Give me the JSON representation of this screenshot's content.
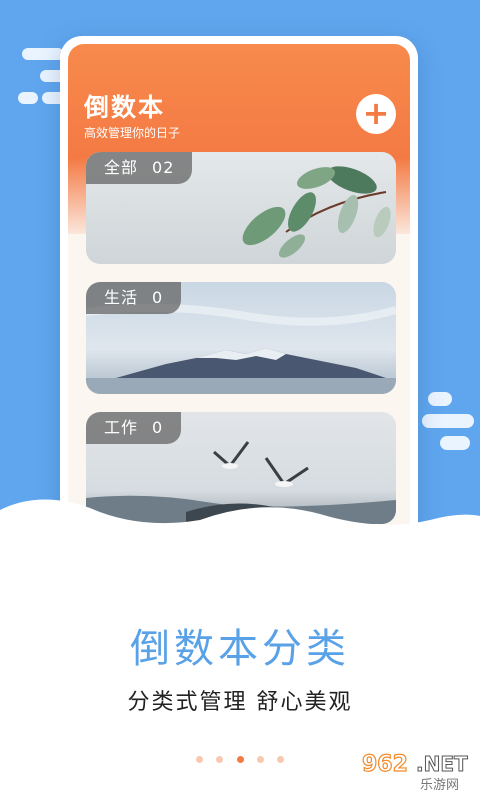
{
  "app": {
    "title": "倒数本",
    "subtitle": "高效管理你的日子",
    "add_icon": "plus-icon",
    "accent_color": "#f47a44"
  },
  "categories": [
    {
      "name": "全部",
      "count": "02",
      "image": "leaves"
    },
    {
      "name": "生活",
      "count": "0",
      "image": "mountain"
    },
    {
      "name": "工作",
      "count": "0",
      "image": "seagulls"
    }
  ],
  "promo": {
    "headline": "倒数本分类",
    "subline": "分类式管理  舒心美观",
    "headline_color": "#5aa2e8"
  },
  "pager": {
    "count": 5,
    "active_index": 2
  },
  "watermark": {
    "number": "962",
    "suffix": ".NET",
    "label": "乐游网"
  }
}
